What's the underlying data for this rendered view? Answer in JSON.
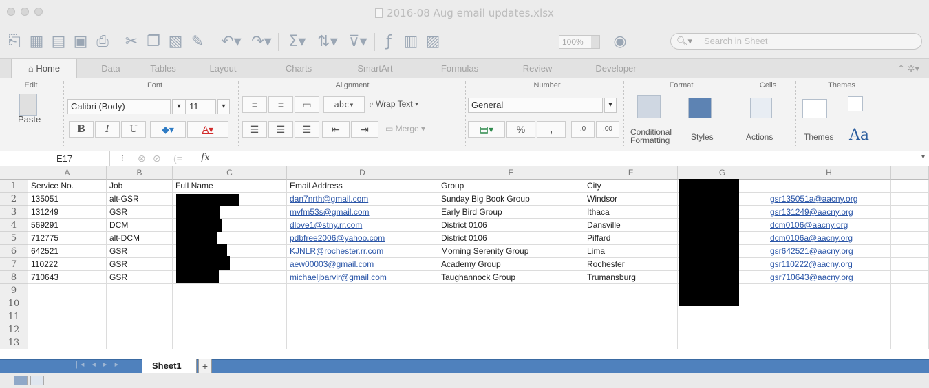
{
  "window": {
    "title": "2016-08 Aug email updates.xlsx"
  },
  "toolbar": {
    "zoom": "100%",
    "search_placeholder": "Search in Sheet"
  },
  "tabs": [
    "Home",
    "Data",
    "Tables",
    "Layout",
    "Charts",
    "SmartArt",
    "Formulas",
    "Review",
    "Developer"
  ],
  "ribbon": {
    "groups": {
      "edit": "Edit",
      "font": "Font",
      "alignment": "Alignment",
      "number": "Number",
      "format": "Format",
      "cells": "Cells",
      "themes": "Themes"
    },
    "paste_label": "Paste",
    "font_name": "Calibri (Body)",
    "font_size": "11",
    "abc": "abc",
    "wrap_text": "Wrap Text",
    "merge": "Merge",
    "number_format": "General",
    "conditional_formatting": "Conditional Formatting",
    "styles": "Styles",
    "actions": "Actions",
    "themes": "Themes",
    "aa": "Aa"
  },
  "formula_bar": {
    "cell_ref": "E17",
    "fx": "fx",
    "value": ""
  },
  "columns": [
    "A",
    "B",
    "C",
    "D",
    "E",
    "F",
    "G",
    "H"
  ],
  "rows": [
    {
      "num": "1",
      "cells": [
        "Service No.",
        "Job",
        "Full Name",
        "Email Address",
        "Group",
        "City",
        "",
        ""
      ]
    },
    {
      "num": "2",
      "cells": [
        "135051",
        "alt-GSR",
        "",
        "dan7nrth@gmail.com",
        "Sunday Big Book Group",
        "Windsor",
        "",
        "gsr135051a@aacny.org"
      ]
    },
    {
      "num": "3",
      "cells": [
        "131249",
        "GSR",
        "",
        "mvfm53s@gmail.com",
        "Early Bird Group",
        "Ithaca",
        "",
        "gsr131249@aacny.org"
      ]
    },
    {
      "num": "4",
      "cells": [
        "569291",
        "DCM",
        "",
        "dlove1@stny.rr.com",
        "District 0106",
        "Dansville",
        "",
        "dcm0106@aacny.org"
      ]
    },
    {
      "num": "5",
      "cells": [
        "712775",
        "alt-DCM",
        "",
        "pdbfree2006@yahoo.com",
        "District 0106",
        "Piffard",
        "",
        "dcm0106a@aacny.org"
      ]
    },
    {
      "num": "6",
      "cells": [
        "642521",
        "GSR",
        "",
        "KJNLR@rochester.rr.com",
        "Morning Serenity Group",
        "Lima",
        "",
        "gsr642521@aacny.org"
      ]
    },
    {
      "num": "7",
      "cells": [
        "110222",
        "GSR",
        "",
        "aew00003@gmail.com",
        "Academy Group",
        "Rochester",
        "",
        "gsr110222@aacny.org"
      ]
    },
    {
      "num": "8",
      "cells": [
        "710643",
        "GSR",
        "",
        "michaeljbarvir@gmail.com",
        "Taughannock Group",
        "Trumansburg",
        "",
        "gsr710643@aacny.org"
      ]
    },
    {
      "num": "9",
      "cells": [
        "",
        "",
        "",
        "",
        "",
        "",
        "",
        ""
      ]
    },
    {
      "num": "10",
      "cells": [
        "",
        "",
        "",
        "",
        "",
        "",
        "",
        ""
      ]
    },
    {
      "num": "11",
      "cells": [
        "",
        "",
        "",
        "",
        "",
        "",
        "",
        ""
      ]
    },
    {
      "num": "12",
      "cells": [
        "",
        "",
        "",
        "",
        "",
        "",
        "",
        ""
      ]
    },
    {
      "num": "13",
      "cells": [
        "",
        "",
        "",
        "",
        "",
        "",
        "",
        ""
      ]
    }
  ],
  "sheets": {
    "active": "Sheet1",
    "add": "+"
  },
  "colors": {
    "sheet_bar": "#4f81bd",
    "link": "#2b56a8"
  }
}
